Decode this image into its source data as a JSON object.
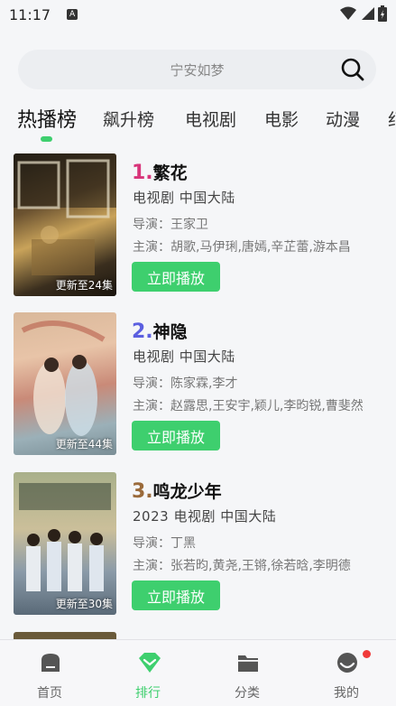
{
  "status": {
    "time": "11:17",
    "badge": "A"
  },
  "search": {
    "placeholder": "宁安如梦"
  },
  "tabs": [
    "热播榜",
    "飙升榜",
    "电视剧",
    "电影",
    "动漫",
    "纪"
  ],
  "items": [
    {
      "rank": "1.",
      "rank_color": "#d8357a",
      "title": "繁花",
      "meta": "电视剧  中国大陆",
      "director": "导演：王家卫",
      "cast": "主演：胡歌,马伊琍,唐嫣,辛芷蕾,游本昌",
      "badge": "更新至24集",
      "play": "立即播放"
    },
    {
      "rank": "2.",
      "rank_color": "#5b5fe0",
      "title": "神隐",
      "meta": "电视剧  中国大陆",
      "director": "导演：陈家霖,李才",
      "cast": "主演：赵露思,王安宇,颖儿,李昀锐,曹斐然",
      "badge": "更新至44集",
      "play": "立即播放"
    },
    {
      "rank": "3.",
      "rank_color": "#9a6a3a",
      "title": "鸣龙少年",
      "meta": "2023  电视剧  中国大陆",
      "director": "导演：丁黑",
      "cast": "主演：张若昀,黄尧,王锵,徐若晗,李明德",
      "badge": "更新至30集",
      "play": "立即播放"
    }
  ],
  "nav": [
    {
      "label": "首页",
      "icon": "home-icon"
    },
    {
      "label": "排行",
      "icon": "diamond-icon"
    },
    {
      "label": "分类",
      "icon": "folder-icon"
    },
    {
      "label": "我的",
      "icon": "profile-icon"
    }
  ],
  "colors": {
    "accent": "#3ecf6e"
  }
}
